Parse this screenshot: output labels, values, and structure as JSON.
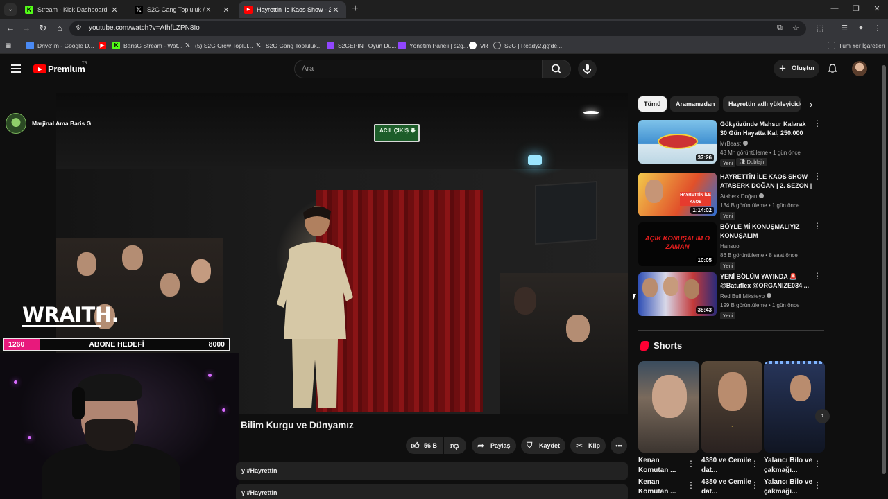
{
  "browser": {
    "tabs": [
      {
        "title": "Stream - Kick Dashboard",
        "favicon": "kick-icon",
        "color": "#53fc18"
      },
      {
        "title": "S2G Gang Topluluk / X",
        "favicon": "x-icon",
        "color": "#000000"
      },
      {
        "title": "Hayrettin ile Kaos Show - 2.Sezon",
        "favicon": "youtube-icon",
        "color": "#ff0000"
      }
    ],
    "new_tab": "+",
    "url": "youtube.com/watch?v=AfhfLZPN8Io",
    "bookmarks": [
      {
        "label": "Drive'ım - Google D...",
        "icon": "drive-icon",
        "color": "#4a8af4"
      },
      {
        "label": "BarisG Stream - Wat...",
        "icon": "kick-icon",
        "color": "#53fc18"
      },
      {
        "label": "(5) S2G Crew Toplul...",
        "icon": "x-icon",
        "color": "#000000"
      },
      {
        "label": "S2G Gang Topluluk...",
        "icon": "x-icon",
        "color": "#000000"
      },
      {
        "label": "S2GEPIN | Oyun Dü...",
        "icon": "twitch-icon",
        "color": "#9146ff"
      },
      {
        "label": "Yönetim Paneli | s2g...",
        "icon": "twitch-icon",
        "color": "#9146ff"
      },
      {
        "label": "VR",
        "icon": "github-icon",
        "color": "#ffffff"
      },
      {
        "label": "S2G | Ready2.gg'de...",
        "icon": "globe-icon",
        "color": "#aaaaaa"
      }
    ],
    "all_bookmarks": "Tüm Yer İşaretleri"
  },
  "youtube": {
    "logo_text": "Premium",
    "logo_sup": "TR",
    "search_placeholder": "Ara",
    "create_label": "Oluştur",
    "accent": "#ff0000"
  },
  "overlay": {
    "streamer_name": "Marjinal Ama Baris G",
    "sponsor": "WRAITH.",
    "goal": {
      "current": "1260",
      "label": "ABONE HEDEFİ",
      "target": "8000",
      "progress": 0.1575,
      "color": "#e8197c"
    },
    "exit_sign": "ACİL ÇIKIŞ"
  },
  "video": {
    "title": "Bilim Kurgu ve Dünyamız",
    "likes": "56 B",
    "share": "Paylaş",
    "save": "Kaydet",
    "clip": "Klip",
    "description_rows": [
      "y #Hayrettin",
      "y #Hayrettin"
    ]
  },
  "chips": [
    "Tümü",
    "Aramanızdan",
    "Hayrettin adlı yükleyiciden"
  ],
  "recommendations": [
    {
      "title": "Gökyüzünde Mahsur Kalarak 30 Gün Hayatta Kal, 250.000 Dola...",
      "channel": "MrBeast",
      "verified": true,
      "meta": "43 Mn görüntüleme • 1 gün önce",
      "badges": [
        "Yeni",
        "Dublajlı"
      ],
      "duration": "37:26"
    },
    {
      "title": "HAYRETTİN İLE KAOS SHOW ATABERK DOĞAN | 2. SEZON | ...",
      "channel": "Ataberk Doğan",
      "verified": true,
      "meta": "134 B görüntüleme • 1 gün önce",
      "badges": [
        "Yeni"
      ],
      "duration": "1:14:02"
    },
    {
      "title": "BÖYLE Mİ KONUŞMALIYIZ KONUŞALIM",
      "channel": "Hansuo",
      "verified": false,
      "meta": "86 B görüntüleme • 8 saat önce",
      "badges": [
        "Yeni"
      ],
      "duration": "10:05",
      "thumb_text": "AÇIK KONUŞALIM O ZAMAN"
    },
    {
      "title": "YENİ BÖLÜM YAYINDA 🚨 @Batuflex @ORGANIZE034 ...",
      "channel": "Red Bull Mikstеyp",
      "verified": true,
      "meta": "199 B görüntüleme • 1 gün önce",
      "badges": [
        "Yeni"
      ],
      "duration": "38:43"
    }
  ],
  "shorts": {
    "heading": "Shorts",
    "items": [
      {
        "title_1": "Kenan Komutan ...",
        "title_2": "Kenan Komutan ..."
      },
      {
        "title_1": "4380 ve Cemile dat...",
        "title_2": "4380 ve Cemile dat..."
      },
      {
        "title_1": "Yalancı Bilo ve çakmağı...",
        "title_2": "Yalancı Bilo ve çakmağı..."
      }
    ]
  }
}
